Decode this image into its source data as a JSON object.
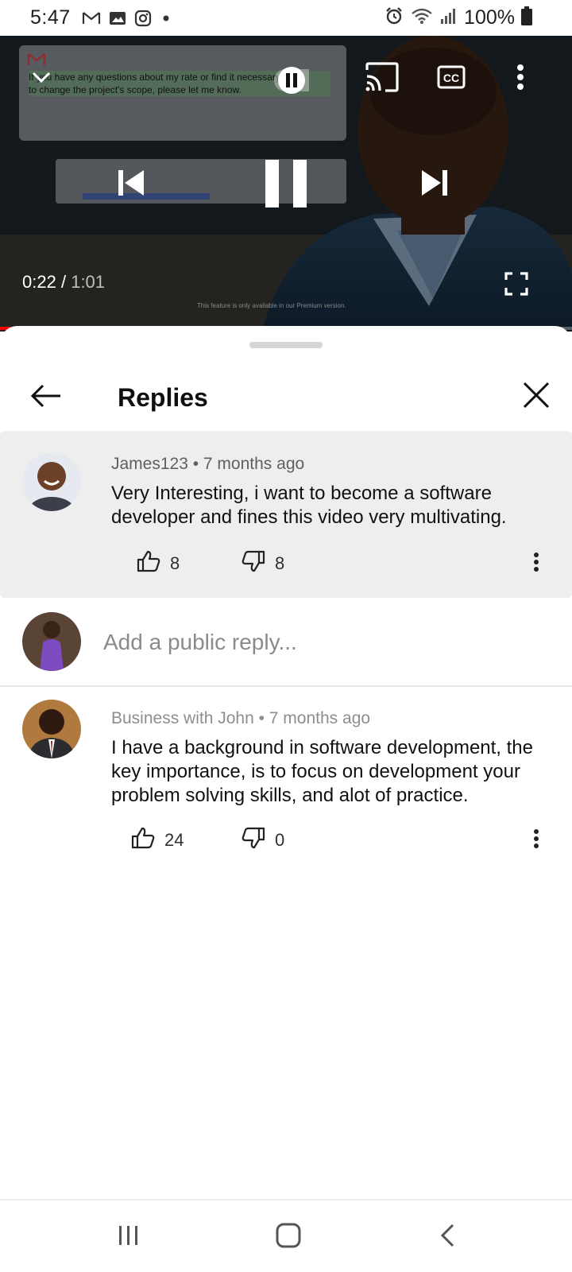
{
  "status_bar": {
    "time": "5:47",
    "battery": "100%",
    "icons": [
      "gmail-icon",
      "gallery-icon",
      "instagram-icon",
      "dot-icon",
      "alarm-icon",
      "wifi-icon",
      "signal-icon",
      "battery-icon"
    ]
  },
  "video": {
    "current_time": "0:22",
    "separator": "/",
    "duration": "1:01",
    "progress_fraction": 0.36,
    "progress_color": "#ff0000",
    "overlay_text_line1": "If you have any questions about my rate or find it necessary",
    "overlay_text_line2": "to change the project's scope, please let me know.",
    "premium_note": "This feature is only available in our Premium version."
  },
  "sheet": {
    "title": "Replies"
  },
  "parent_comment": {
    "author": "James123",
    "time": "7 months ago",
    "text": "Very Interesting, i want to become a software developer and fines this video very multivating.",
    "likes": "8",
    "dislikes": "8"
  },
  "reply_box": {
    "placeholder": "Add a public reply..."
  },
  "replies": [
    {
      "author": "Business with John",
      "time": "7 months ago",
      "text": "I have a background in software development, the key importance, is to focus on development your problem solving skills, and alot of practice.",
      "likes": "24",
      "dislikes": "0"
    }
  ]
}
